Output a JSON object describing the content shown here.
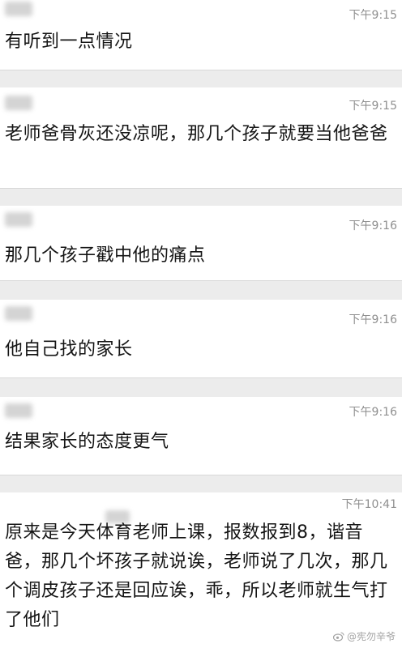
{
  "messages": [
    {
      "time": "下午9:15",
      "text": "有听到一点情况"
    },
    {
      "time": "下午9:15",
      "text": "老师爸骨灰还没凉呢，那几个孩子就要当他爸爸"
    },
    {
      "time": "下午9:16",
      "text": "那几个孩子戳中他的痛点"
    },
    {
      "time": "下午9:16",
      "text": "他自己找的家长"
    },
    {
      "time": "下午9:16",
      "text": "结果家长的态度更气"
    },
    {
      "time": "下午10:41",
      "text": "原来是今天体育老师上课，报数报到8，谐音爸，那几个坏孩子就说诶，老师说了几次，那几个调皮孩子还是回应诶，乖，所以老师就生气打了他们"
    }
  ],
  "watermark": {
    "text": "@宪勿辛爷",
    "icon": "weibo-icon"
  }
}
